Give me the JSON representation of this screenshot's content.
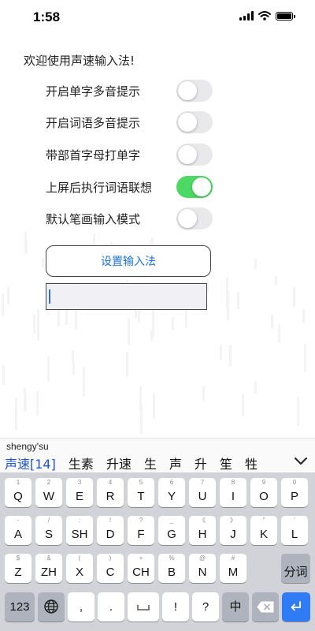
{
  "status_bar": {
    "time": "1:58"
  },
  "welcome_text": "欢迎使用声速输入法!",
  "settings": [
    {
      "label": "开启单字多音提示",
      "on": false
    },
    {
      "label": "开启词语多音提示",
      "on": false
    },
    {
      "label": "带部首字母打单字",
      "on": false
    },
    {
      "label": "上屏后执行词语联想",
      "on": true
    },
    {
      "label": "默认笔画输入模式",
      "on": false
    }
  ],
  "setup_button": "设置输入法",
  "text_input": {
    "value": ""
  },
  "ime": {
    "composition": "shengy'su",
    "candidates": [
      "声速[14]",
      "生素",
      "升速",
      "生",
      "声",
      "升",
      "笙",
      "牲"
    ],
    "rows": [
      [
        {
          "hint": "1",
          "label": "Q"
        },
        {
          "hint": "2",
          "label": "W"
        },
        {
          "hint": "3",
          "label": "E"
        },
        {
          "hint": "4",
          "label": "R"
        },
        {
          "hint": "5",
          "label": "T"
        },
        {
          "hint": "6",
          "label": "Y"
        },
        {
          "hint": "7",
          "label": "U"
        },
        {
          "hint": "8",
          "label": "I"
        },
        {
          "hint": "9",
          "label": "O"
        },
        {
          "hint": "0",
          "label": "P"
        }
      ],
      [
        {
          "hint": "-",
          "label": "A"
        },
        {
          "hint": "/",
          "label": "S"
        },
        {
          "hint": ":",
          "label": "SH"
        },
        {
          "hint": "!",
          "label": "D"
        },
        {
          "hint": "?",
          "label": "F"
        },
        {
          "hint": "_",
          "label": "G"
        },
        {
          "hint": "《",
          "label": "H"
        },
        {
          "hint": "》",
          "label": "J"
        },
        {
          "hint": "\"",
          "label": "K"
        },
        {
          "hint": "'",
          "label": "L"
        }
      ],
      [
        {
          "hint": "$",
          "label": "Z"
        },
        {
          "hint": "&",
          "label": "ZH"
        },
        {
          "hint": "(",
          "label": "X"
        },
        {
          "hint": ")",
          "label": "C"
        },
        {
          "hint": "+",
          "label": "CH"
        },
        {
          "hint": "%",
          "label": "B"
        },
        {
          "hint": "@",
          "label": "N"
        },
        {
          "hint": "#",
          "label": "M"
        },
        {
          "hint": "",
          "label": "分词"
        }
      ]
    ],
    "bottom_row": {
      "numbers_label": "123",
      "comma_label": ",",
      "period_label": ".",
      "exclaim_label": "!",
      "question_label": "?",
      "chinese_label": "中"
    }
  },
  "colors": {
    "toggle_on": "#4cd964",
    "toggle_off": "#e9e9eb",
    "button_text": "#1e73d6",
    "candidate_selected": "#2255cc",
    "keyboard_bg": "#d1d3d9",
    "return_key": "#2f7cf6"
  }
}
